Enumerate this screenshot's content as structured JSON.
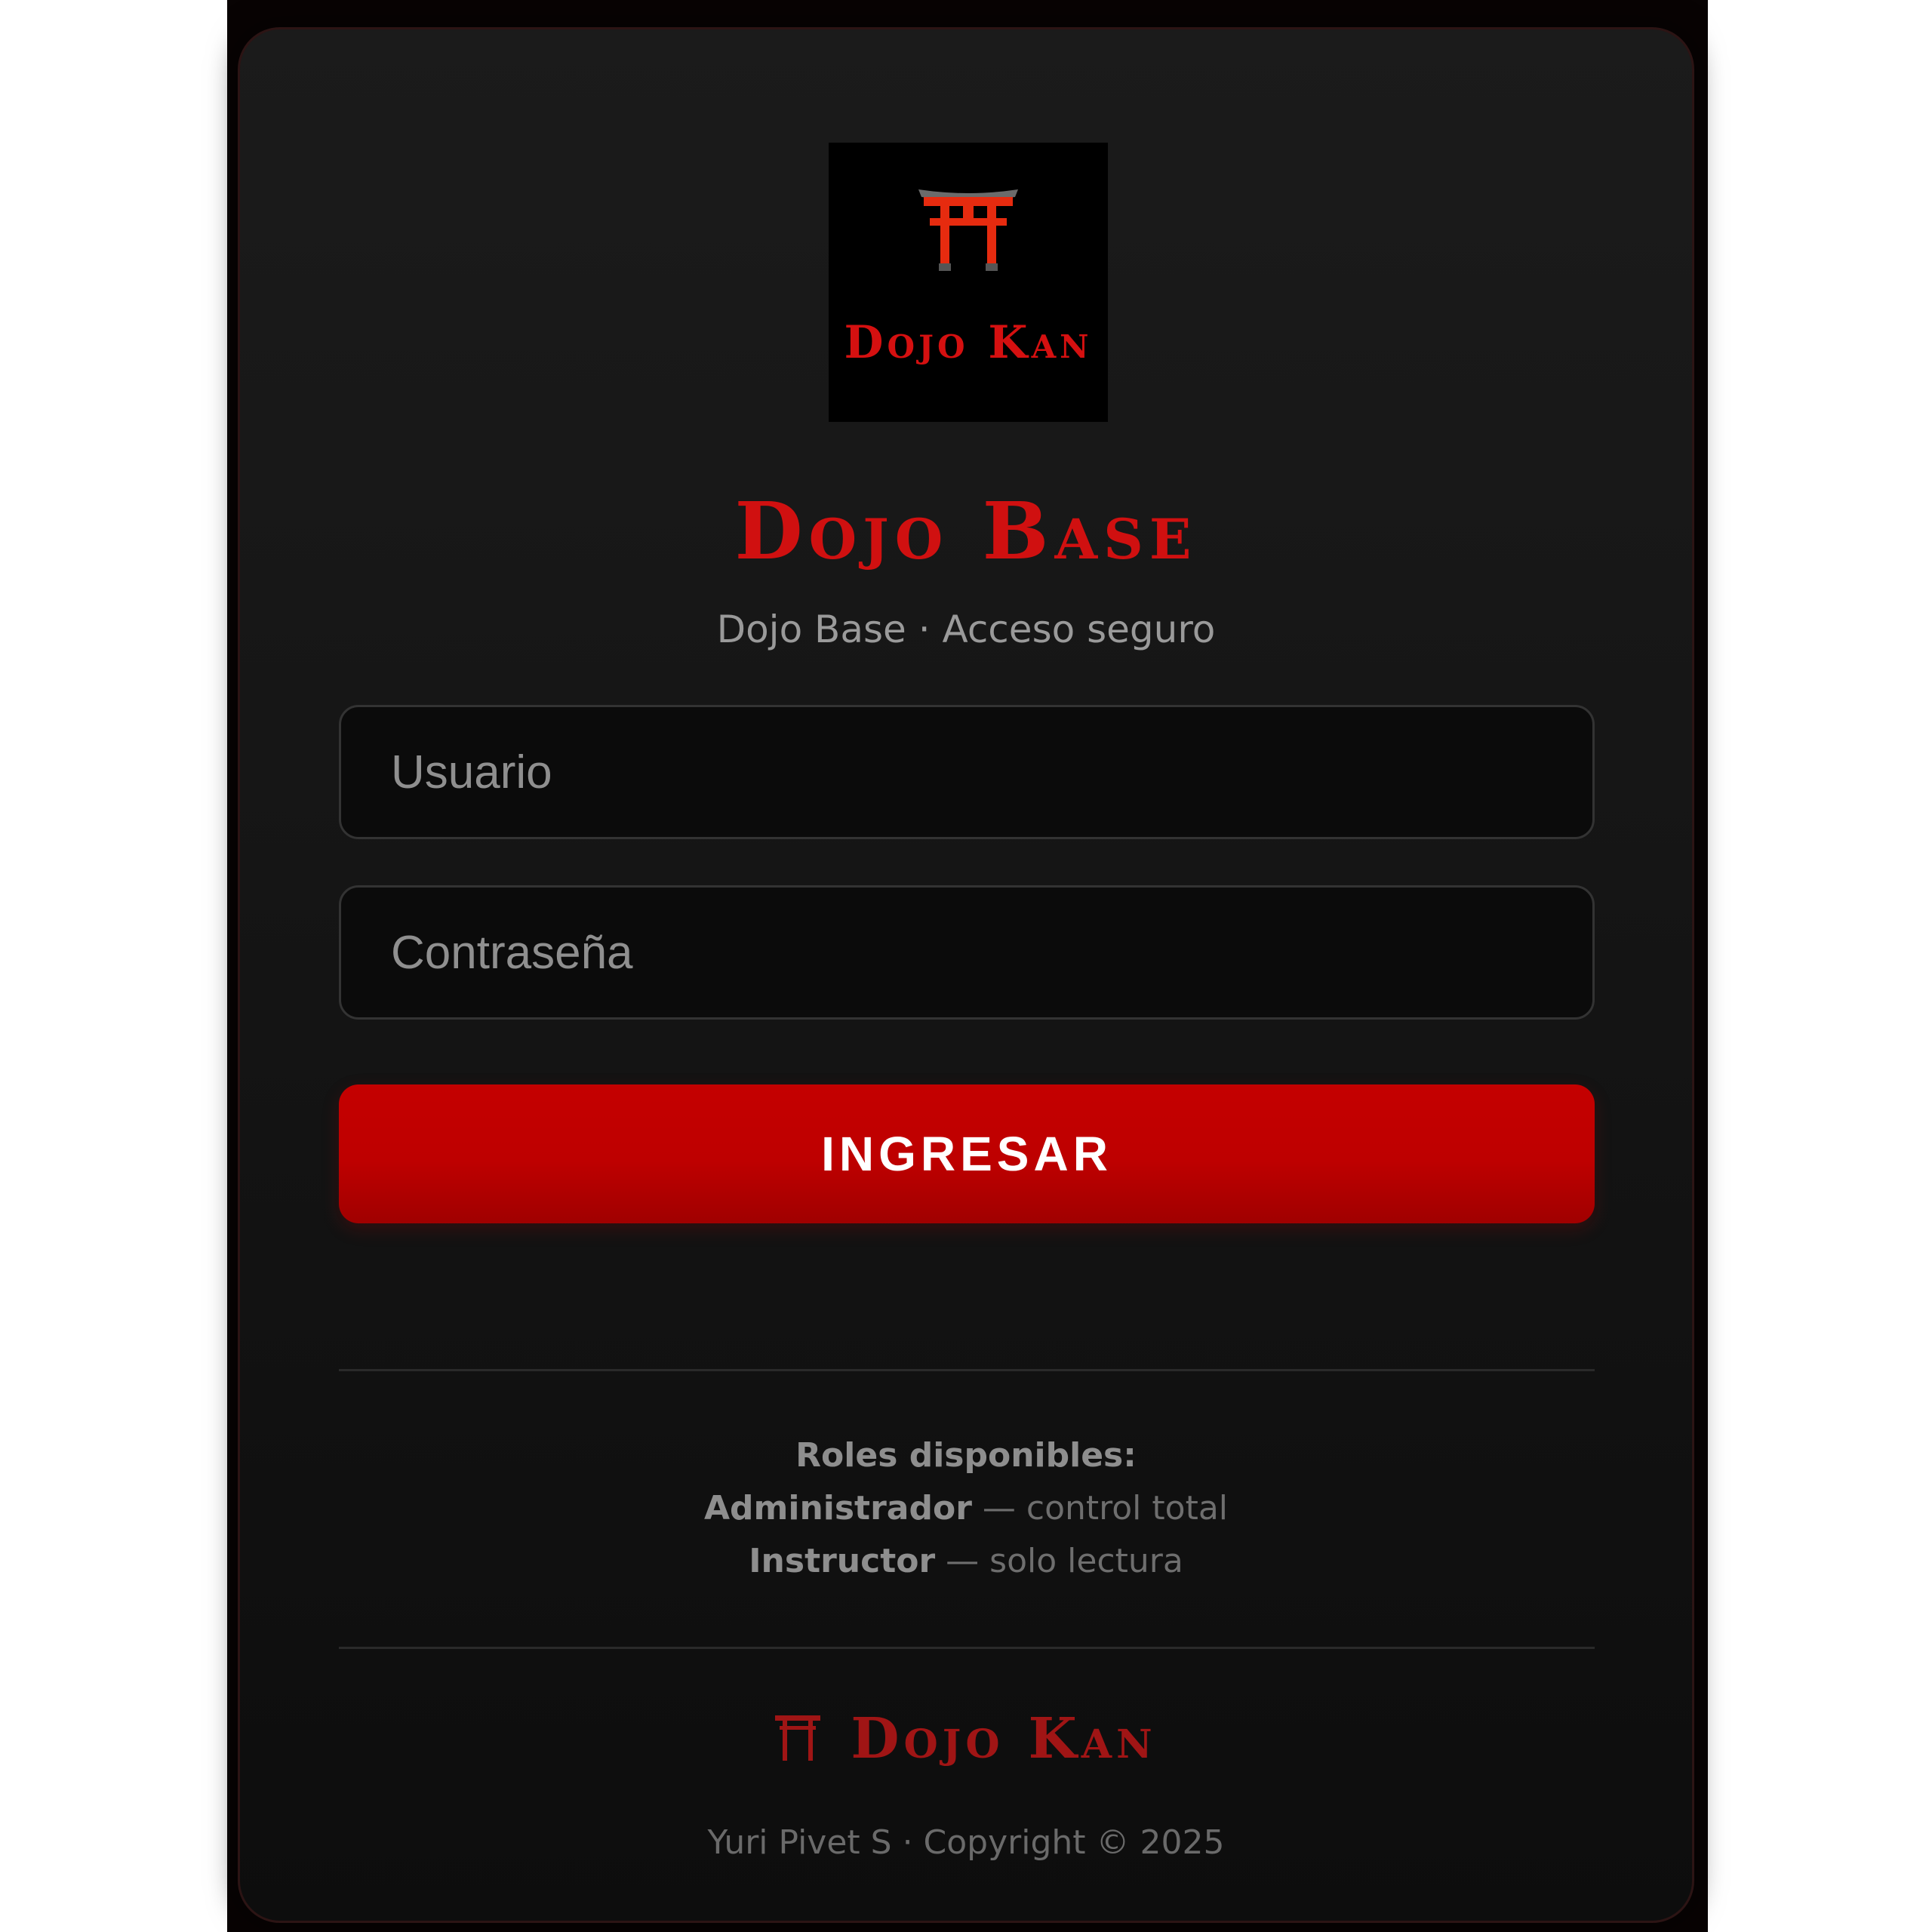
{
  "logo": {
    "text": "Dojo Kan",
    "icon": "torii-gate-icon",
    "colors": {
      "gate": "#e62b0f",
      "roof": "#6b6b6b",
      "text": "#d51010"
    }
  },
  "header": {
    "title": "Dojo Base",
    "subtitle": "Dojo Base · Acceso seguro"
  },
  "form": {
    "username_placeholder": "Usuario",
    "password_placeholder": "Contraseña",
    "submit_label": "INGRESAR"
  },
  "roles": {
    "heading": "Roles disponibles:",
    "items": [
      {
        "name": "Administrador",
        "separator": " — ",
        "description": "control total"
      },
      {
        "name": "Instructor",
        "separator": " — ",
        "description": "solo lectura"
      }
    ]
  },
  "footer": {
    "brand": "Dojo Kan",
    "brand_icon": "torii-gate-icon",
    "copyright": "Yuri Pivet S · Copyright © 2025"
  },
  "colors": {
    "accent": "#c00000",
    "background": "#141414",
    "border": "#2c1414"
  }
}
